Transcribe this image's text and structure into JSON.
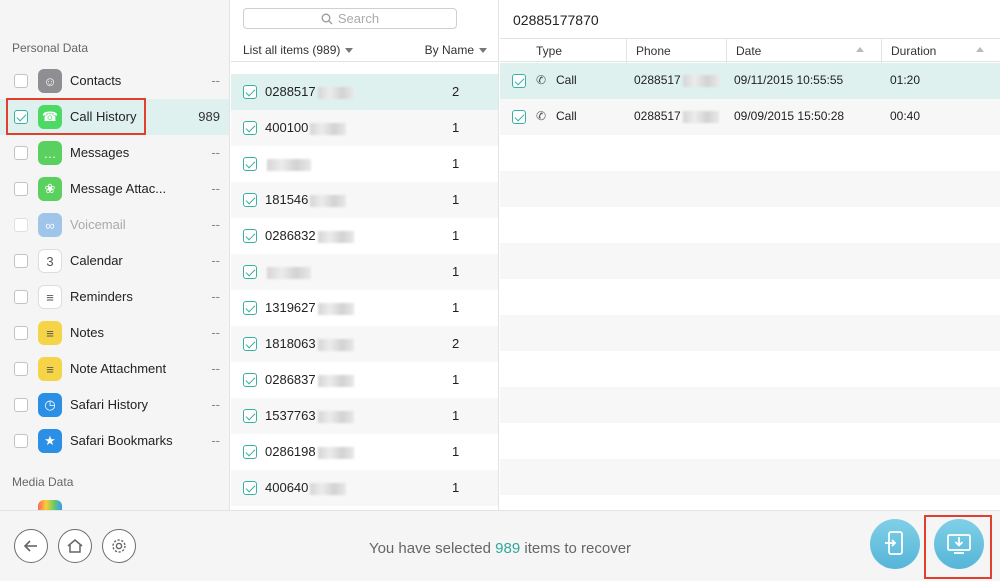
{
  "sidebar": {
    "personal_title": "Personal Data",
    "media_title": "Media Data",
    "items": [
      {
        "label": "Contacts",
        "count": "--",
        "icon": "contacts-icon",
        "color": "#8e8e93",
        "checked": false,
        "disabled": false
      },
      {
        "label": "Call History",
        "count": "989",
        "icon": "phone-icon",
        "color": "#4cd964",
        "checked": true,
        "disabled": false
      },
      {
        "label": "Messages",
        "count": "--",
        "icon": "messages-icon",
        "color": "#5ad05e",
        "checked": false,
        "disabled": false
      },
      {
        "label": "Message Attac...",
        "count": "--",
        "icon": "message-attachment-icon",
        "color": "#5ad05e",
        "checked": false,
        "disabled": false
      },
      {
        "label": "Voicemail",
        "count": "--",
        "icon": "voicemail-icon",
        "color": "#3a8de0",
        "checked": false,
        "disabled": true
      },
      {
        "label": "Calendar",
        "count": "--",
        "icon": "calendar-icon",
        "color": "#ffffff",
        "checked": false,
        "disabled": false
      },
      {
        "label": "Reminders",
        "count": "--",
        "icon": "reminders-icon",
        "color": "#ffffff",
        "checked": false,
        "disabled": false
      },
      {
        "label": "Notes",
        "count": "--",
        "icon": "notes-icon",
        "color": "#f5d547",
        "checked": false,
        "disabled": false
      },
      {
        "label": "Note Attachment",
        "count": "--",
        "icon": "note-attachment-icon",
        "color": "#f5d547",
        "checked": false,
        "disabled": false
      },
      {
        "label": "Safari History",
        "count": "--",
        "icon": "safari-history-icon",
        "color": "#2c8fe6",
        "checked": false,
        "disabled": false
      },
      {
        "label": "Safari Bookmarks",
        "count": "--",
        "icon": "safari-bookmarks-icon",
        "color": "#2c8fe6",
        "checked": false,
        "disabled": false
      }
    ]
  },
  "middle": {
    "search_placeholder": "Search",
    "list_header": "List all items (989)",
    "sort_label": "By Name",
    "rows": [
      {
        "number": "0288517",
        "count": "2"
      },
      {
        "number": "400100",
        "count": "1"
      },
      {
        "number": "",
        "count": "1"
      },
      {
        "number": "181546",
        "count": "1"
      },
      {
        "number": "0286832",
        "count": "1"
      },
      {
        "number": "",
        "count": "1"
      },
      {
        "number": "1319627",
        "count": "1"
      },
      {
        "number": "1818063",
        "count": "2"
      },
      {
        "number": "0286837",
        "count": "1"
      },
      {
        "number": "1537763",
        "count": "1"
      },
      {
        "number": "0286198",
        "count": "1"
      },
      {
        "number": "400640",
        "count": "1"
      }
    ]
  },
  "detail": {
    "title": "02885177870",
    "columns": {
      "type": "Type",
      "phone": "Phone",
      "date": "Date",
      "duration": "Duration"
    },
    "rows": [
      {
        "type": "Call",
        "phone": "0288517",
        "date": "09/11/2015 10:55:55",
        "duration": "01:20"
      },
      {
        "type": "Call",
        "phone": "0288517",
        "date": "09/09/2015 15:50:28",
        "duration": "00:40"
      }
    ]
  },
  "bottom": {
    "status_prefix": "You have selected ",
    "status_count": "989",
    "status_suffix": " items to recover"
  },
  "colors": {
    "accent": "#2fa99c",
    "highlight_box": "#e2402f",
    "selected_row": "#dff1ef"
  }
}
